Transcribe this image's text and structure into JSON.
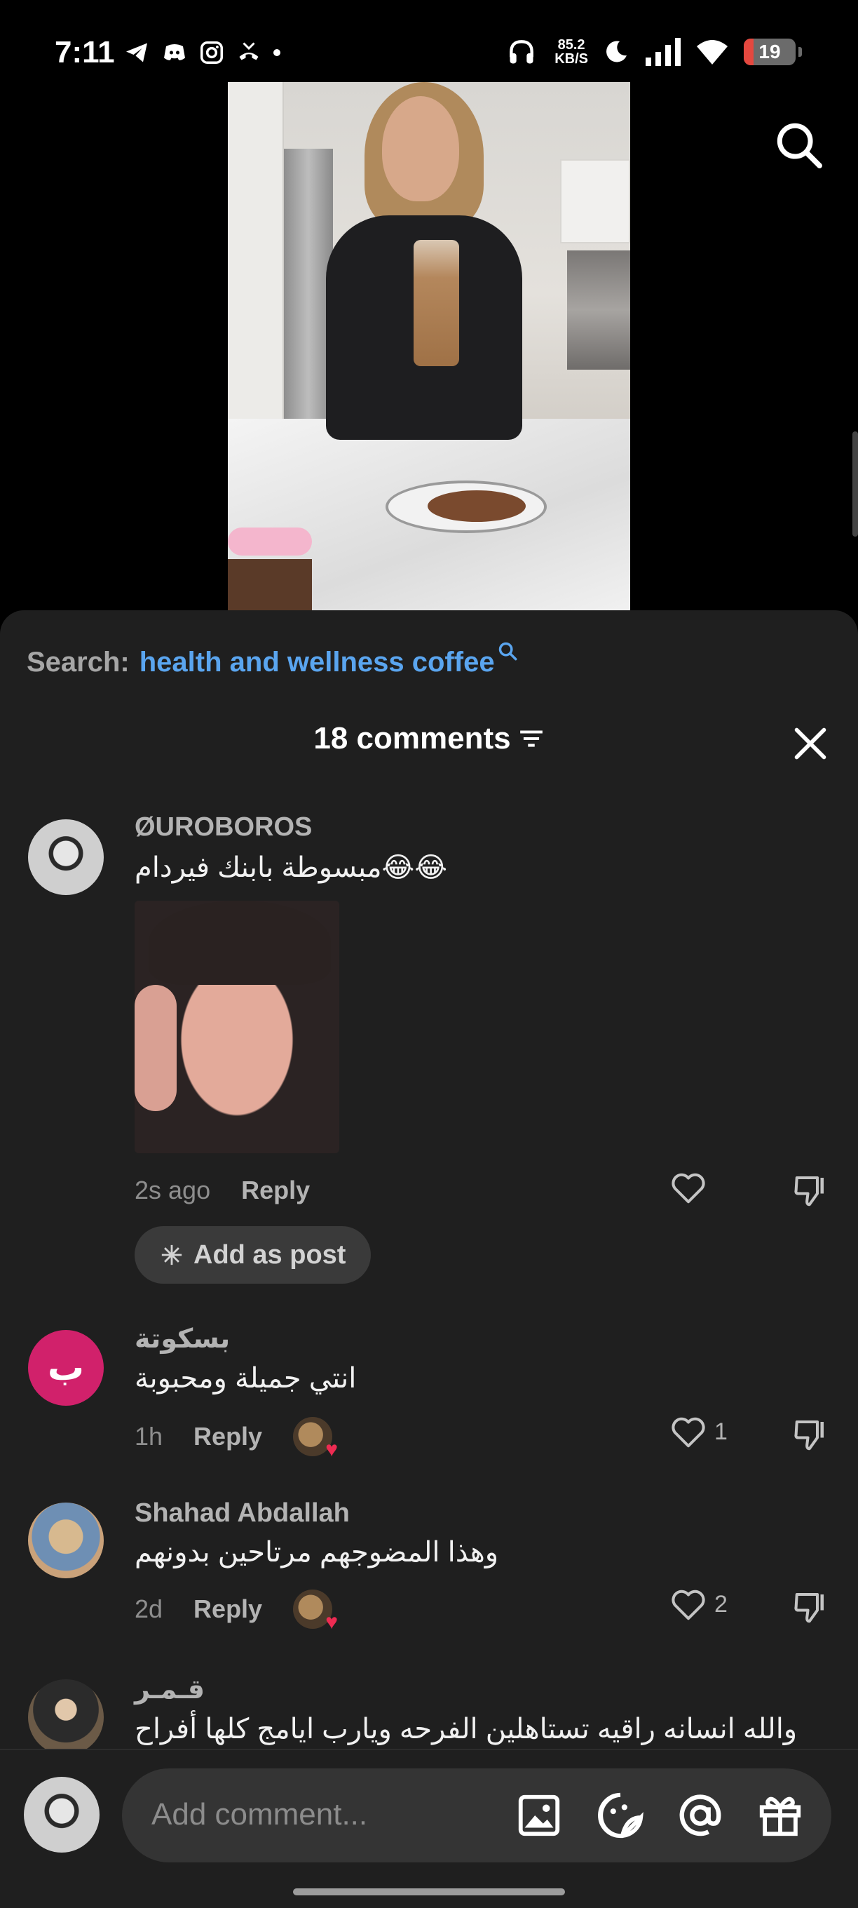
{
  "status_bar": {
    "time": "7:11",
    "net_speed_value": "85.2",
    "net_speed_unit": "KB/S",
    "battery": "19",
    "battery_level": 0.19,
    "battery_color": "#e5483f"
  },
  "search": {
    "label": "Search:",
    "term": "health and wellness coffee",
    "term_color": "#5aa5ef"
  },
  "comments_header": {
    "title": "18 comments"
  },
  "comments": [
    {
      "name": "ØUROBOROS",
      "text": "مبسوطة بابنك فيردام😂😂",
      "time": "2s ago",
      "reply": "Reply",
      "likes": "",
      "add_post": "Add as post"
    },
    {
      "name": "بسكوتة",
      "avatar_letter": "ب",
      "text": "انتي جميلة ومحبوبة",
      "time": "1h",
      "reply": "Reply",
      "likes": "1"
    },
    {
      "name": "Shahad Abdallah",
      "text": "وهذا المضوجهم مرتاحين بدونهم",
      "time": "2d",
      "reply": "Reply",
      "likes": "2"
    },
    {
      "name": "قـمـر",
      "text": "والله انسانه راقيه تستاهلين الفرحه ويارب ايامج كلها أفراح"
    }
  ],
  "composer": {
    "placeholder": "Add comment..."
  },
  "icons": [
    "telegram-icon",
    "discord-icon",
    "instagram-icon",
    "missed-call-icon",
    "headphones-icon",
    "moon-icon",
    "signal-icon",
    "wifi-icon",
    "search-icon",
    "filter-icon",
    "close-icon",
    "heart-icon",
    "dislike-icon",
    "sparkle-icon",
    "image-icon",
    "sticker-icon",
    "mention-icon",
    "gift-icon"
  ]
}
